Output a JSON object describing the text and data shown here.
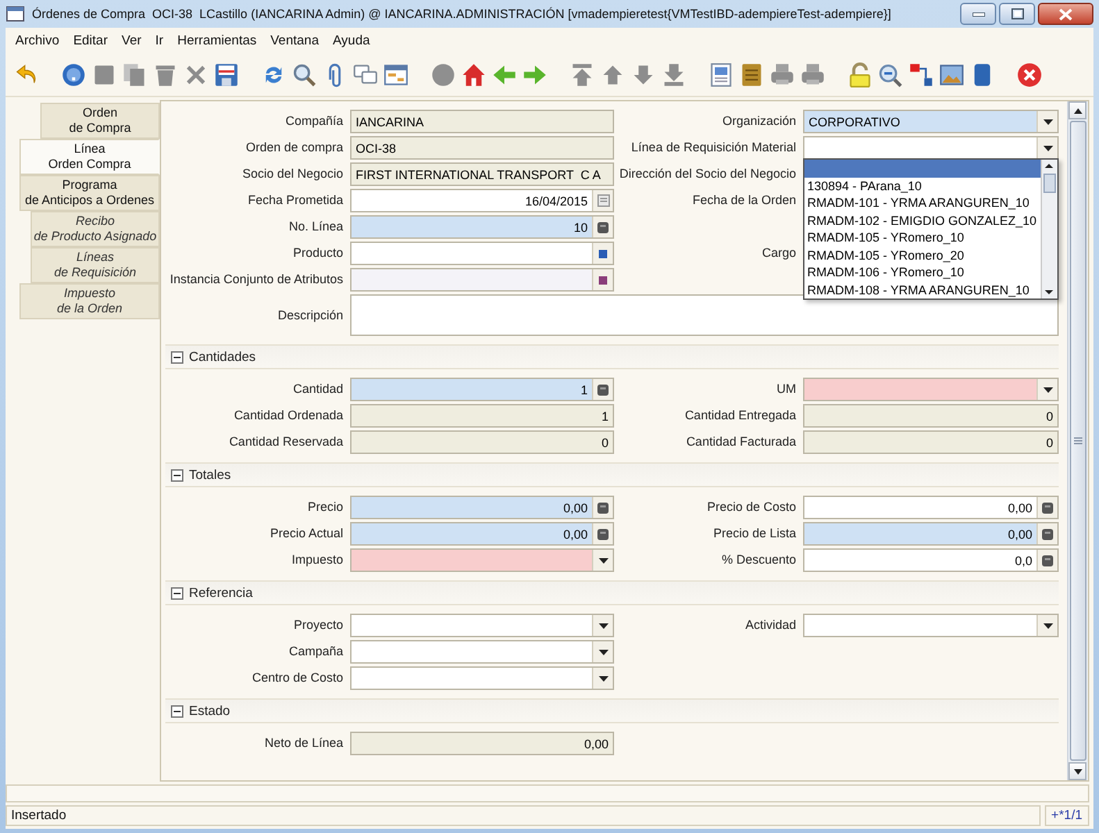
{
  "window": {
    "title": "Órdenes de Compra  OCI-38  LCastillo (IANCARINA Admin) @ IANCARINA.ADMINISTRACIÓN [vmadempieretest{VMTestIBD-adempiereTest-adempiere}]"
  },
  "menu": [
    "Archivo",
    "Editar",
    "Ver",
    "Ir",
    "Herramientas",
    "Ventana",
    "Ayuda"
  ],
  "tabs": [
    {
      "lines": [
        "Orden",
        "de Compra"
      ],
      "selected": false,
      "disabled": false,
      "children": [
        {
          "lines": [
            "Línea",
            "Orden Compra"
          ],
          "selected": true,
          "disabled": false
        },
        {
          "lines": [
            "Programa",
            "de Anticipos a Ordenes"
          ],
          "selected": false,
          "disabled": false,
          "children": [
            {
              "lines": [
                "Recibo",
                "de Producto Asignado"
              ],
              "selected": false,
              "disabled": true
            },
            {
              "lines": [
                "Líneas",
                "de Requisición"
              ],
              "selected": false,
              "disabled": true
            }
          ]
        },
        {
          "lines": [
            "Impuesto",
            "de la Orden"
          ],
          "selected": false,
          "disabled": true
        }
      ]
    }
  ],
  "form": {
    "header_rows": [
      {
        "left": {
          "label": "Compañía",
          "value": "IANCARINA",
          "kind": "text",
          "disabled": false,
          "readonly": true
        },
        "right": {
          "label": "Organización",
          "value": "CORPORATIVO",
          "kind": "combo",
          "disabled": false,
          "readonly": false,
          "mandatory": true
        }
      },
      {
        "left": {
          "label": "Orden de compra",
          "value": "OCI-38",
          "kind": "text",
          "disabled": false,
          "readonly": true
        },
        "right": {
          "label": "Línea de Requisición Material",
          "kind": "combo",
          "disabled": false,
          "readonly": false,
          "mandatory": false,
          "options": [
            {
              "selected": true
            },
            {
              "label": "130894 - PArana_10",
              "selected": false
            },
            {
              "label": "RMADM-101 - YRMA ARANGUREN_10",
              "selected": false
            },
            {
              "label": "RMADM-102 - EMIGDIO GONZALEZ_10",
              "selected": false
            },
            {
              "label": "RMADM-105 - YRomero_10",
              "selected": false
            },
            {
              "label": "RMADM-105 - YRomero_20",
              "selected": false
            },
            {
              "label": "RMADM-106 - YRomero_10",
              "selected": false
            },
            {
              "label": "RMADM-108 - YRMA ARANGUREN_10",
              "selected": false
            }
          ]
        }
      },
      {
        "left": {
          "label": "Socio del Negocio",
          "value": "FIRST INTERNATIONAL TRANSPORT  C A",
          "kind": "text",
          "disabled": false,
          "readonly": true
        },
        "right": {
          "label": "Dirección del Socio del Negocio"
        }
      },
      {
        "left": {
          "label": "Fecha Prometida",
          "value": "16/04/2015",
          "kind": "date",
          "disabled": false,
          "readonly": false,
          "mandatory": false
        },
        "right": {
          "label": "Fecha de la Orden"
        }
      },
      {
        "left": {
          "label": "No. Línea",
          "value": "10",
          "kind": "number",
          "disabled": false,
          "readonly": false,
          "mandatory": true
        }
      },
      {
        "left": {
          "label": "Producto",
          "kind": "lookup",
          "disabled": false,
          "readonly": false,
          "mandatory": false
        },
        "right": {
          "label": "Cargo"
        }
      },
      {
        "left": {
          "label": "Instancia Conjunto de Atributos",
          "kind": "lookup",
          "disabled": true
        }
      },
      {
        "left": {
          "label": "Descripción",
          "kind": "textarea",
          "disabled": false,
          "readonly": false,
          "mandatory": false
        }
      }
    ],
    "sections": [
      {
        "title": "Cantidades",
        "expanded": true,
        "rows": [
          {
            "left": {
              "label": "Cantidad",
              "value": "1",
              "kind": "number",
              "disabled": false,
              "readonly": false,
              "mandatory": true
            },
            "right": {
              "label": "UM",
              "kind": "combo",
              "disabled": false,
              "readonly": false,
              "mandatory": true
            }
          },
          {
            "left": {
              "label": "Cantidad Ordenada",
              "value": "1",
              "kind": "amount",
              "disabled": false,
              "readonly": true
            },
            "right": {
              "label": "Cantidad Entregada",
              "value": "0",
              "kind": "amount",
              "disabled": false,
              "readonly": true
            }
          },
          {
            "left": {
              "label": "Cantidad Reservada",
              "value": "0",
              "kind": "amount",
              "disabled": false,
              "readonly": true
            },
            "right": {
              "label": "Cantidad Facturada",
              "value": "0",
              "kind": "amount",
              "disabled": false,
              "readonly": true
            }
          }
        ]
      },
      {
        "title": "Totales",
        "expanded": true,
        "rows": [
          {
            "left": {
              "label": "Precio",
              "value": "0,00",
              "kind": "number",
              "disabled": false,
              "readonly": false,
              "mandatory": true
            },
            "right": {
              "label": "Precio de Costo",
              "value": "0,00",
              "kind": "number",
              "disabled": false,
              "readonly": false,
              "mandatory": false
            }
          },
          {
            "left": {
              "label": "Precio Actual",
              "value": "0,00",
              "kind": "number",
              "disabled": false,
              "readonly": false,
              "mandatory": true
            },
            "right": {
              "label": "Precio de Lista",
              "value": "0,00",
              "kind": "number",
              "disabled": false,
              "readonly": false,
              "mandatory": true
            }
          },
          {
            "left": {
              "label": "Impuesto",
              "kind": "combo",
              "disabled": false,
              "readonly": false,
              "mandatory": true
            },
            "right": {
              "label": "% Descuento",
              "value": "0,0",
              "kind": "number",
              "disabled": false,
              "readonly": false,
              "mandatory": false
            }
          }
        ]
      },
      {
        "title": "Referencia",
        "expanded": true,
        "rows": [
          {
            "left": {
              "label": "Proyecto",
              "kind": "combo",
              "disabled": false,
              "readonly": false,
              "mandatory": false
            },
            "right": {
              "label": "Actividad",
              "kind": "combo",
              "disabled": false,
              "readonly": false,
              "mandatory": false
            }
          },
          {
            "left": {
              "label": "Campaña",
              "kind": "combo",
              "disabled": false,
              "readonly": false,
              "mandatory": false
            }
          },
          {
            "left": {
              "label": "Centro de Costo",
              "kind": "combo",
              "disabled": false,
              "readonly": false,
              "mandatory": false
            }
          }
        ]
      },
      {
        "title": "Estado",
        "expanded": true,
        "rows": [
          {
            "left": {
              "label": "Neto de Línea",
              "value": "0,00",
              "kind": "amount",
              "disabled": false,
              "readonly": true
            }
          }
        ]
      }
    ]
  },
  "status_bar": {
    "message": "Insertado",
    "record": "+*1/1"
  }
}
